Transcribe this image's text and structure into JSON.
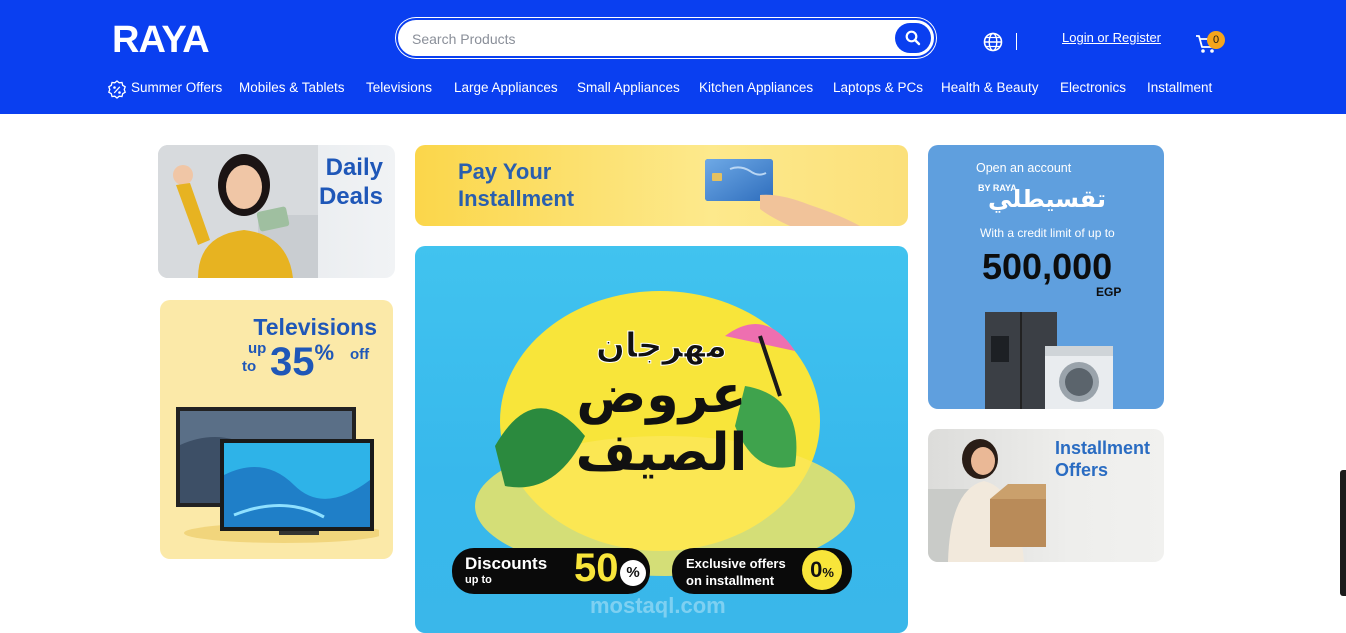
{
  "header": {
    "logo_text": "RAYA",
    "search_placeholder": "Search Products",
    "login_label": "Login or Register",
    "cart_count": "0",
    "colors": {
      "brand": "#0a3ff0",
      "badge": "#f6a51c"
    }
  },
  "nav": {
    "items": [
      {
        "label": "Summer Offers"
      },
      {
        "label": "Mobiles & Tablets"
      },
      {
        "label": "Televisions"
      },
      {
        "label": "Large Appliances"
      },
      {
        "label": "Small Appliances"
      },
      {
        "label": "Kitchen Appliances"
      },
      {
        "label": "Laptops & PCs"
      },
      {
        "label": "Health & Beauty"
      },
      {
        "label": "Electronics"
      },
      {
        "label": "Installment"
      }
    ]
  },
  "banners": {
    "daily_deals": {
      "line1": "Daily",
      "line2": "Deals"
    },
    "televisions": {
      "title": "Televisions",
      "up": "up",
      "to": "to",
      "value": "35",
      "percent": "%",
      "off": "off"
    },
    "pay_installment": {
      "line1": "Pay Your",
      "line2": "Installment"
    },
    "summer": {
      "arabic_line1": "مهرجان",
      "arabic_line2": "عروض",
      "arabic_line3": "الصيف",
      "discounts_label": "Discounts",
      "upto_label": "up to",
      "discount_value": "50",
      "percent": "%",
      "exclusive_line1": "Exclusive offers",
      "exclusive_line2": "on installment",
      "installment_value": "0",
      "watermark": "mostaql.com"
    },
    "account": {
      "open": "Open an account",
      "by": "BY RAYA",
      "brand_ar": "تقسيطلي",
      "credit": "With a credit limit of up to",
      "amount": "500,000",
      "currency": "EGP"
    },
    "installment_offers": {
      "line1": "Installment",
      "line2": "Offers"
    }
  }
}
